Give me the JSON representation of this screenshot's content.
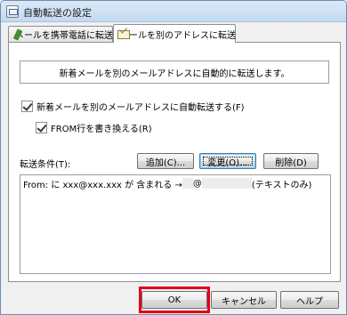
{
  "window": {
    "title": "自動転送の設定"
  },
  "tabs": [
    {
      "label": "メールを携帯電話に転送",
      "icon": "phone-icon",
      "active": false
    },
    {
      "label": "メールを別のアドレスに転送",
      "icon": "mail-icon",
      "active": true
    }
  ],
  "panel": {
    "notice": "新着メールを別のメールアドレスに自動的に転送します。",
    "auto_forward_checkbox": {
      "label": "新着メールを別のメールアドレスに自動転送する(F)",
      "checked": true
    },
    "from_rewrite_checkbox": {
      "label": "FROM行を書き換える(R)",
      "checked": true
    },
    "conditions_label": "転送条件(T):",
    "buttons": {
      "add": "追加(C)...",
      "change": "変更(O)...",
      "delete": "削除(D)"
    },
    "rules": [
      {
        "prefix": "From: に xxx@xxx.xxx が 含まれる →",
        "at": "@",
        "suffix": "(テキストのみ)"
      }
    ]
  },
  "footer": {
    "ok": "OK",
    "cancel": "キャンセル",
    "help": "ヘルプ"
  },
  "colors": {
    "highlight": "#e0001b",
    "focus_border": "#3c7fb1"
  }
}
